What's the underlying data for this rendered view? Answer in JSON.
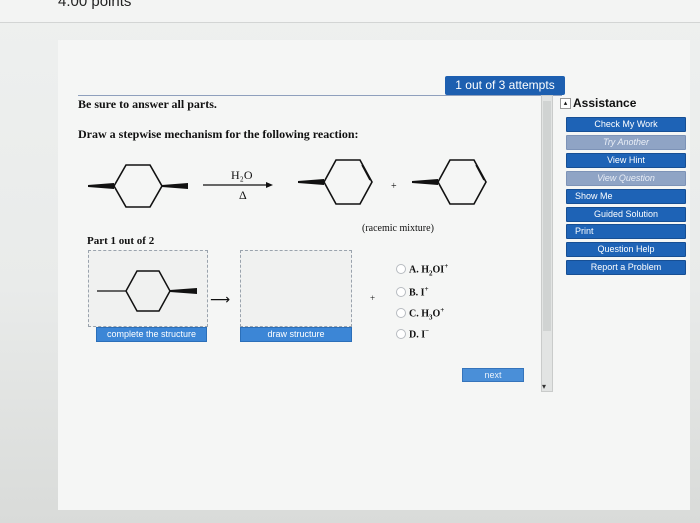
{
  "header": {
    "points": "4.00 points"
  },
  "question": {
    "attempts": "1 out of 3 attempts",
    "instruction": "Be sure to answer all parts.",
    "prompt": "Draw a stepwise mechanism for the following reaction:",
    "reagent_top": "H₂O",
    "reagent_bottom": "Δ",
    "plus": "+",
    "racemic": "(racemic mixture)"
  },
  "part": {
    "label": "Part 1 out of 2",
    "complete_button": "complete the structure",
    "draw_button": "draw structure",
    "plus": "+",
    "options": [
      {
        "letter": "A.",
        "formula": "H₂OI",
        "charge": "+"
      },
      {
        "letter": "B.",
        "formula": "I",
        "charge": "+"
      },
      {
        "letter": "C.",
        "formula": "H₃O",
        "charge": "+"
      },
      {
        "letter": "D.",
        "formula": "I",
        "charge": "−"
      }
    ]
  },
  "assistance": {
    "title": "Assistance",
    "buttons": [
      {
        "label": "Check My Work",
        "enabled": true
      },
      {
        "label": "Try Another",
        "enabled": false
      },
      {
        "label": "View Hint",
        "enabled": true
      },
      {
        "label": "View Question",
        "enabled": false
      },
      {
        "label": "Show Me",
        "enabled": true
      },
      {
        "label": "Guided Solution",
        "enabled": true
      },
      {
        "label": "Print",
        "enabled": true
      },
      {
        "label": "Question Help",
        "enabled": true
      },
      {
        "label": "Report a Problem",
        "enabled": true
      }
    ]
  },
  "footer": {
    "next_label": "next"
  },
  "colors": {
    "accent": "#1d5fb0",
    "button_blue": "#3c86d6",
    "disabled": "#8fa4c5"
  }
}
